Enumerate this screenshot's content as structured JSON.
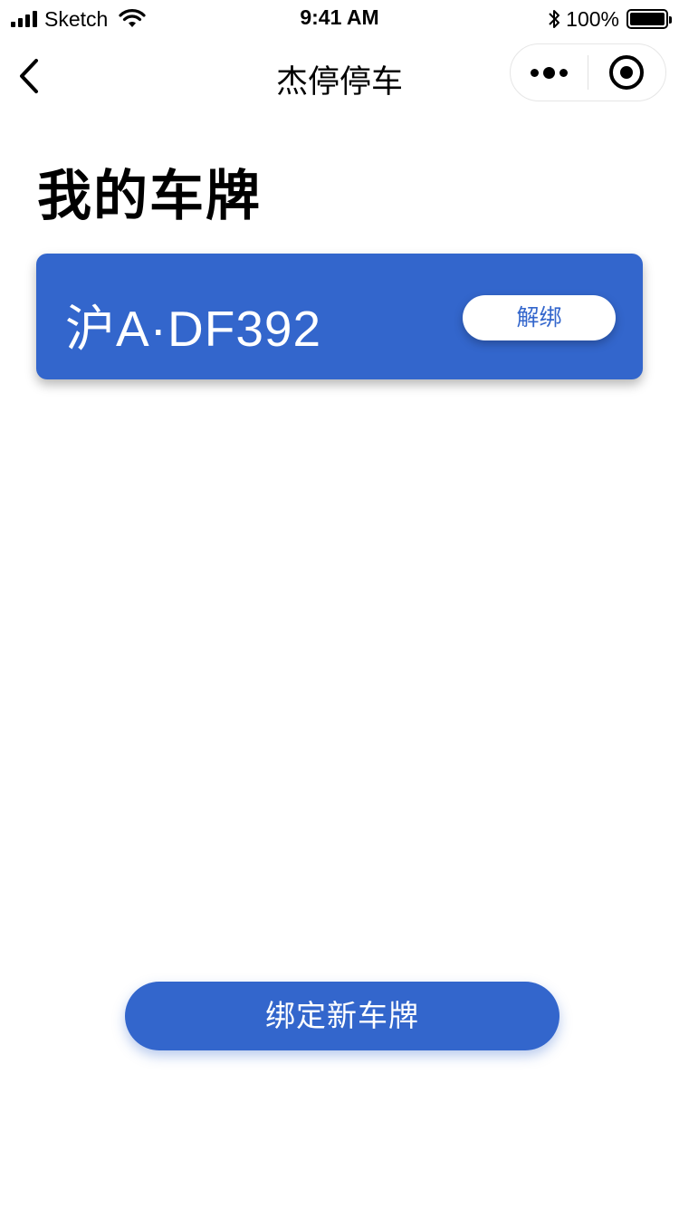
{
  "status_bar": {
    "carrier": "Sketch",
    "time": "9:41 AM",
    "battery_percent": "100%",
    "battery_level": 1.0,
    "signal_bars": 4
  },
  "nav": {
    "title": "杰停停车",
    "icons": {
      "back": "chevron-left-icon",
      "more": "more-dots-icon",
      "close": "target-circle-icon"
    }
  },
  "page": {
    "heading": "我的车牌"
  },
  "plates": [
    {
      "number": "沪A·DF392",
      "action_label": "解绑"
    }
  ],
  "actions": {
    "bind_new_label": "绑定新车牌"
  },
  "colors": {
    "primary": "#3366cc",
    "background": "#ffffff",
    "text": "#000000"
  }
}
